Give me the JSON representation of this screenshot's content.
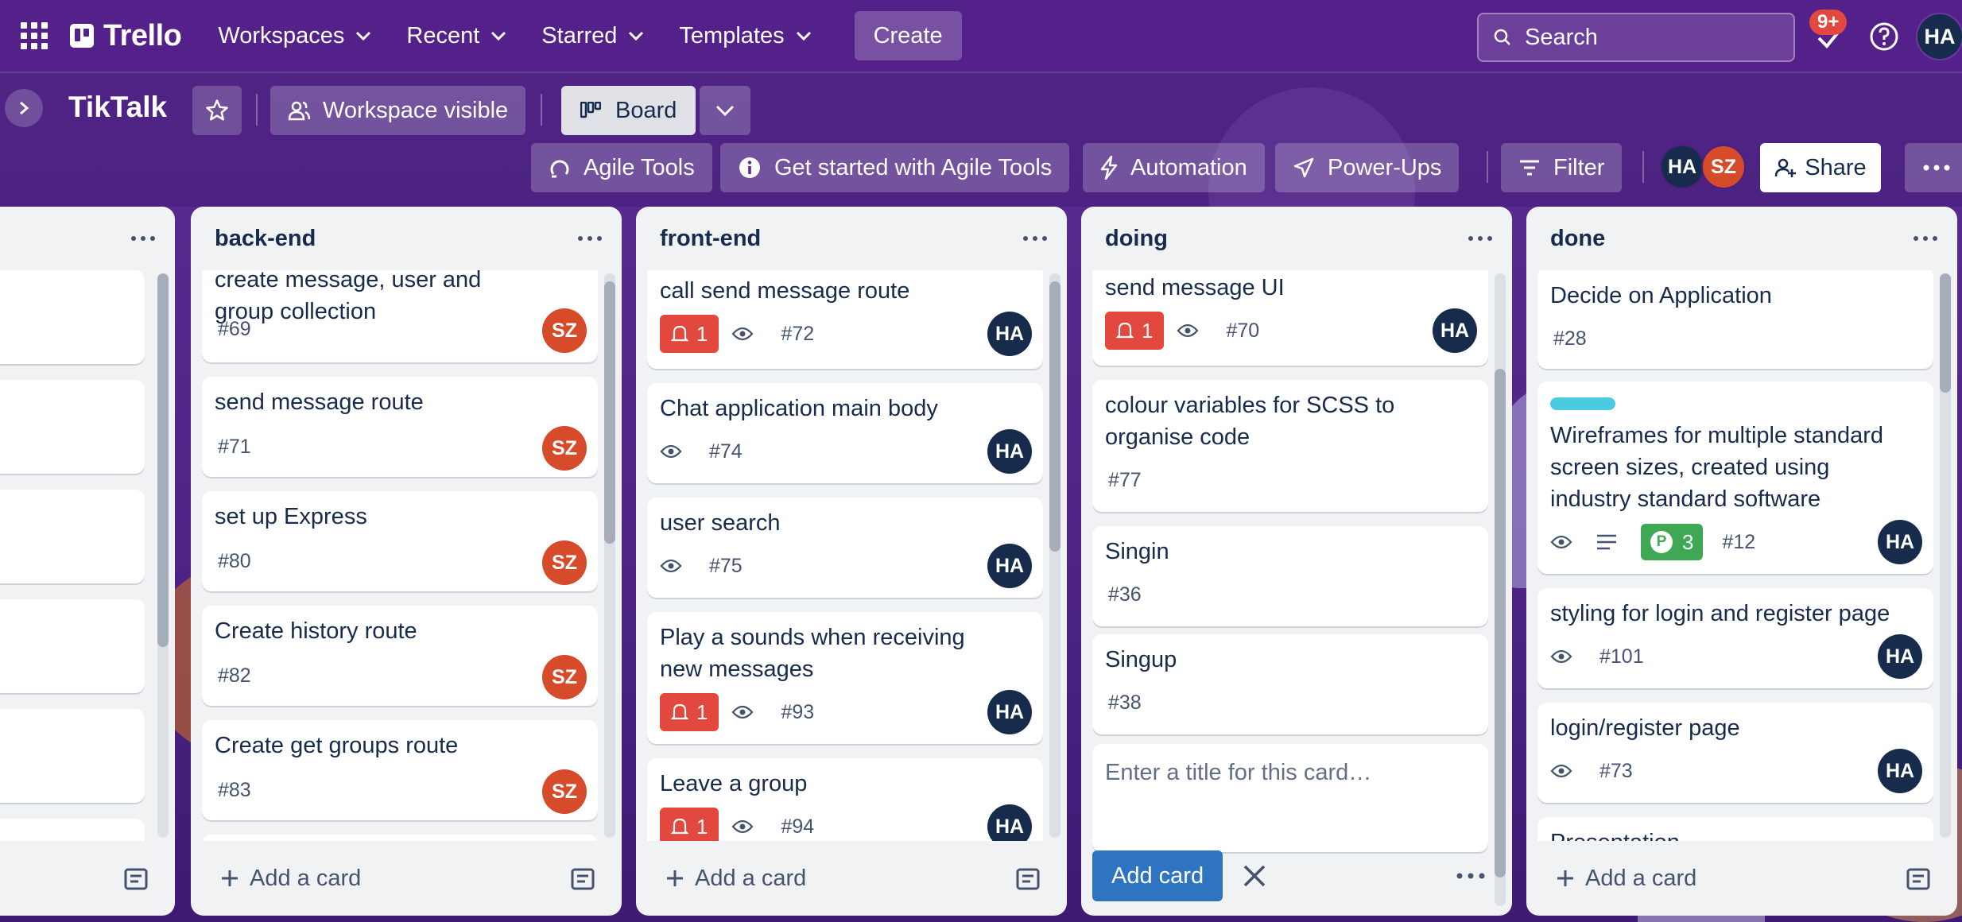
{
  "nav": {
    "logo": "Trello",
    "menus": [
      "Workspaces",
      "Recent",
      "Starred",
      "Templates"
    ],
    "create_label": "Create",
    "search_placeholder": "Search",
    "notifications_badge": "9+",
    "user_initials": "HA"
  },
  "board": {
    "title": "TikTalk",
    "visibility_label": "Workspace visible",
    "view_label": "Board",
    "agile_tools_label": "Agile Tools",
    "get_started_label": "Get started with Agile Tools",
    "automation_label": "Automation",
    "powerups_label": "Power-Ups",
    "filter_label": "Filter",
    "members": [
      {
        "initials": "HA",
        "color": "#172b4d"
      },
      {
        "initials": "SZ",
        "color": "#d64b2a"
      }
    ],
    "share_label": "Share"
  },
  "lists": {
    "partial": {
      "add_card_label": ""
    },
    "backend": {
      "title": "back-end",
      "add_card_label": "Add a card",
      "cards": [
        {
          "title": "create message, user and group collection",
          "number": "#69",
          "avatar": "SZ"
        },
        {
          "title": "send message route",
          "number": "#71",
          "avatar": "SZ"
        },
        {
          "title": "set up Express",
          "number": "#80",
          "avatar": "SZ"
        },
        {
          "title": "Create history route",
          "number": "#82",
          "avatar": "SZ"
        },
        {
          "title": "Create get groups route",
          "number": "#83",
          "avatar": "SZ"
        }
      ]
    },
    "frontend": {
      "title": "front-end",
      "add_card_label": "Add a card",
      "cards": [
        {
          "title": "call send message route",
          "alerts": "1",
          "number": "#72",
          "avatar": "HA"
        },
        {
          "title": "Chat application main body",
          "number": "#74",
          "avatar": "HA"
        },
        {
          "title": "user search",
          "number": "#75",
          "avatar": "HA"
        },
        {
          "title": "Play a sounds when receiving new messages",
          "alerts": "1",
          "number": "#93",
          "avatar": "HA"
        },
        {
          "title": "Leave a group",
          "alerts": "1",
          "number": "#94",
          "avatar": "HA"
        }
      ]
    },
    "doing": {
      "title": "doing",
      "cards": [
        {
          "title": "send message UI",
          "alerts": "1",
          "number": "#70",
          "avatar": "HA"
        },
        {
          "title": "colour variables for SCSS to organise code",
          "number": "#77"
        },
        {
          "title": "Singin",
          "number": "#36"
        },
        {
          "title": "Singup",
          "number": "#38"
        }
      ],
      "composer_placeholder": "Enter a title for this card…",
      "composer_button": "Add card"
    },
    "done": {
      "title": "done",
      "add_card_label": "Add a card",
      "cards": [
        {
          "title": "Decide on Application",
          "number": "#28"
        },
        {
          "title": "Wireframes for multiple standard screen sizes, created using industry standard software",
          "points": "3",
          "points_icon": "P",
          "number": "#12",
          "avatar": "HA",
          "label_color": "#4bcbe0"
        },
        {
          "title": "styling for login and register page",
          "number": "#101",
          "avatar": "HA"
        },
        {
          "title": "login/register page",
          "number": "#73",
          "avatar": "HA"
        },
        {
          "title": "Presentation"
        }
      ]
    }
  },
  "colors": {
    "nav_bg": "#54218a",
    "alert_red": "#e2483d",
    "sz_avatar": "#d64b2a",
    "ha_avatar": "#172b4d",
    "primary_blue": "#2f74c0",
    "points_green": "#3fa855"
  }
}
